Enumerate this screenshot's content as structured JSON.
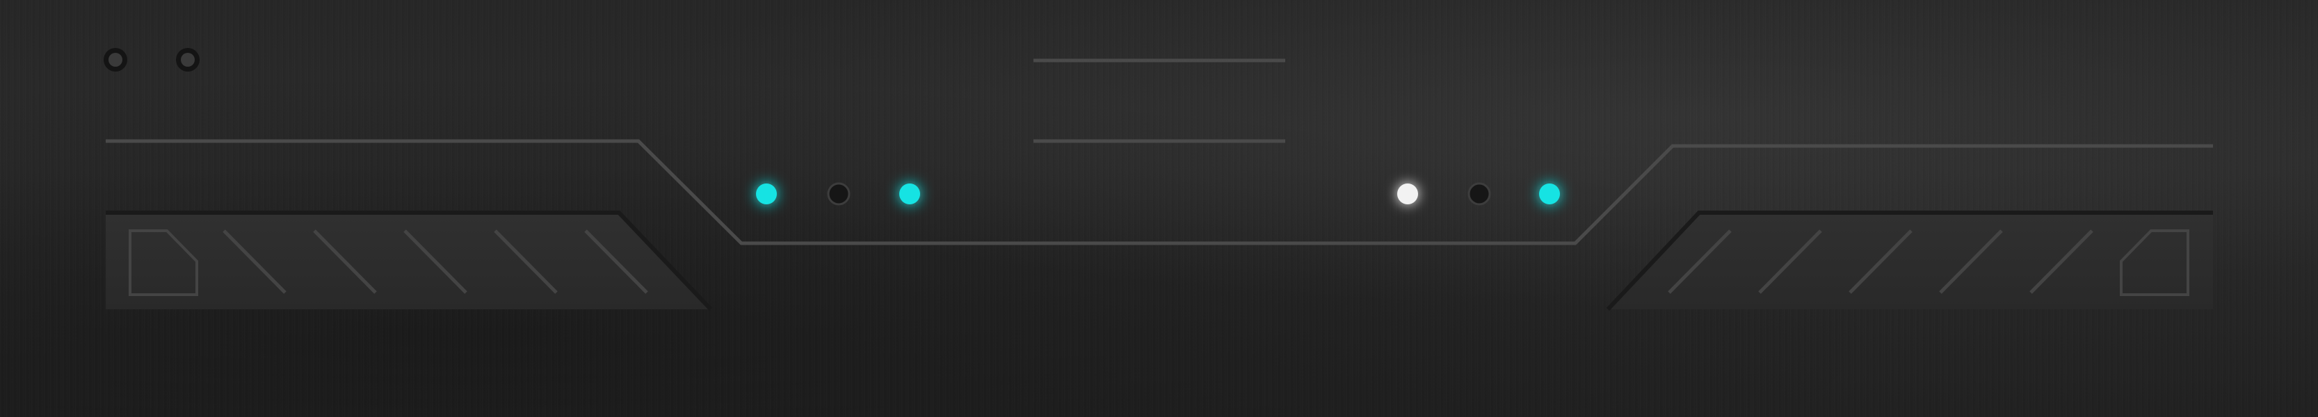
{
  "panel": {
    "style": "brushed-metal hud header",
    "colors": {
      "background": "#262626",
      "line": "#4a4a4a",
      "plate": "#2d2d2d",
      "led_cyan": "#19e3e3",
      "led_white": "#f2f2f2",
      "led_off": "#161616"
    },
    "indicators_left": [
      {
        "name": "indicator-light-1",
        "state": "on",
        "color": "#19e3e3"
      },
      {
        "name": "indicator-light-2",
        "state": "off",
        "color": "#161616"
      },
      {
        "name": "indicator-light-3",
        "state": "on",
        "color": "#19e3e3"
      }
    ],
    "indicators_right": [
      {
        "name": "indicator-light-4",
        "state": "on",
        "color": "#f2f2f2"
      },
      {
        "name": "indicator-light-5",
        "state": "off",
        "color": "#161616"
      },
      {
        "name": "indicator-light-6",
        "state": "on",
        "color": "#19e3e3"
      }
    ],
    "rivets": [
      "screw-icon",
      "screw-icon"
    ],
    "left_stripe_count": 5,
    "right_stripe_count": 5,
    "icons": [
      "screw-icon",
      "notched-corner-icon",
      "diagonal-stripe-icon",
      "led-indicator-icon"
    ]
  }
}
